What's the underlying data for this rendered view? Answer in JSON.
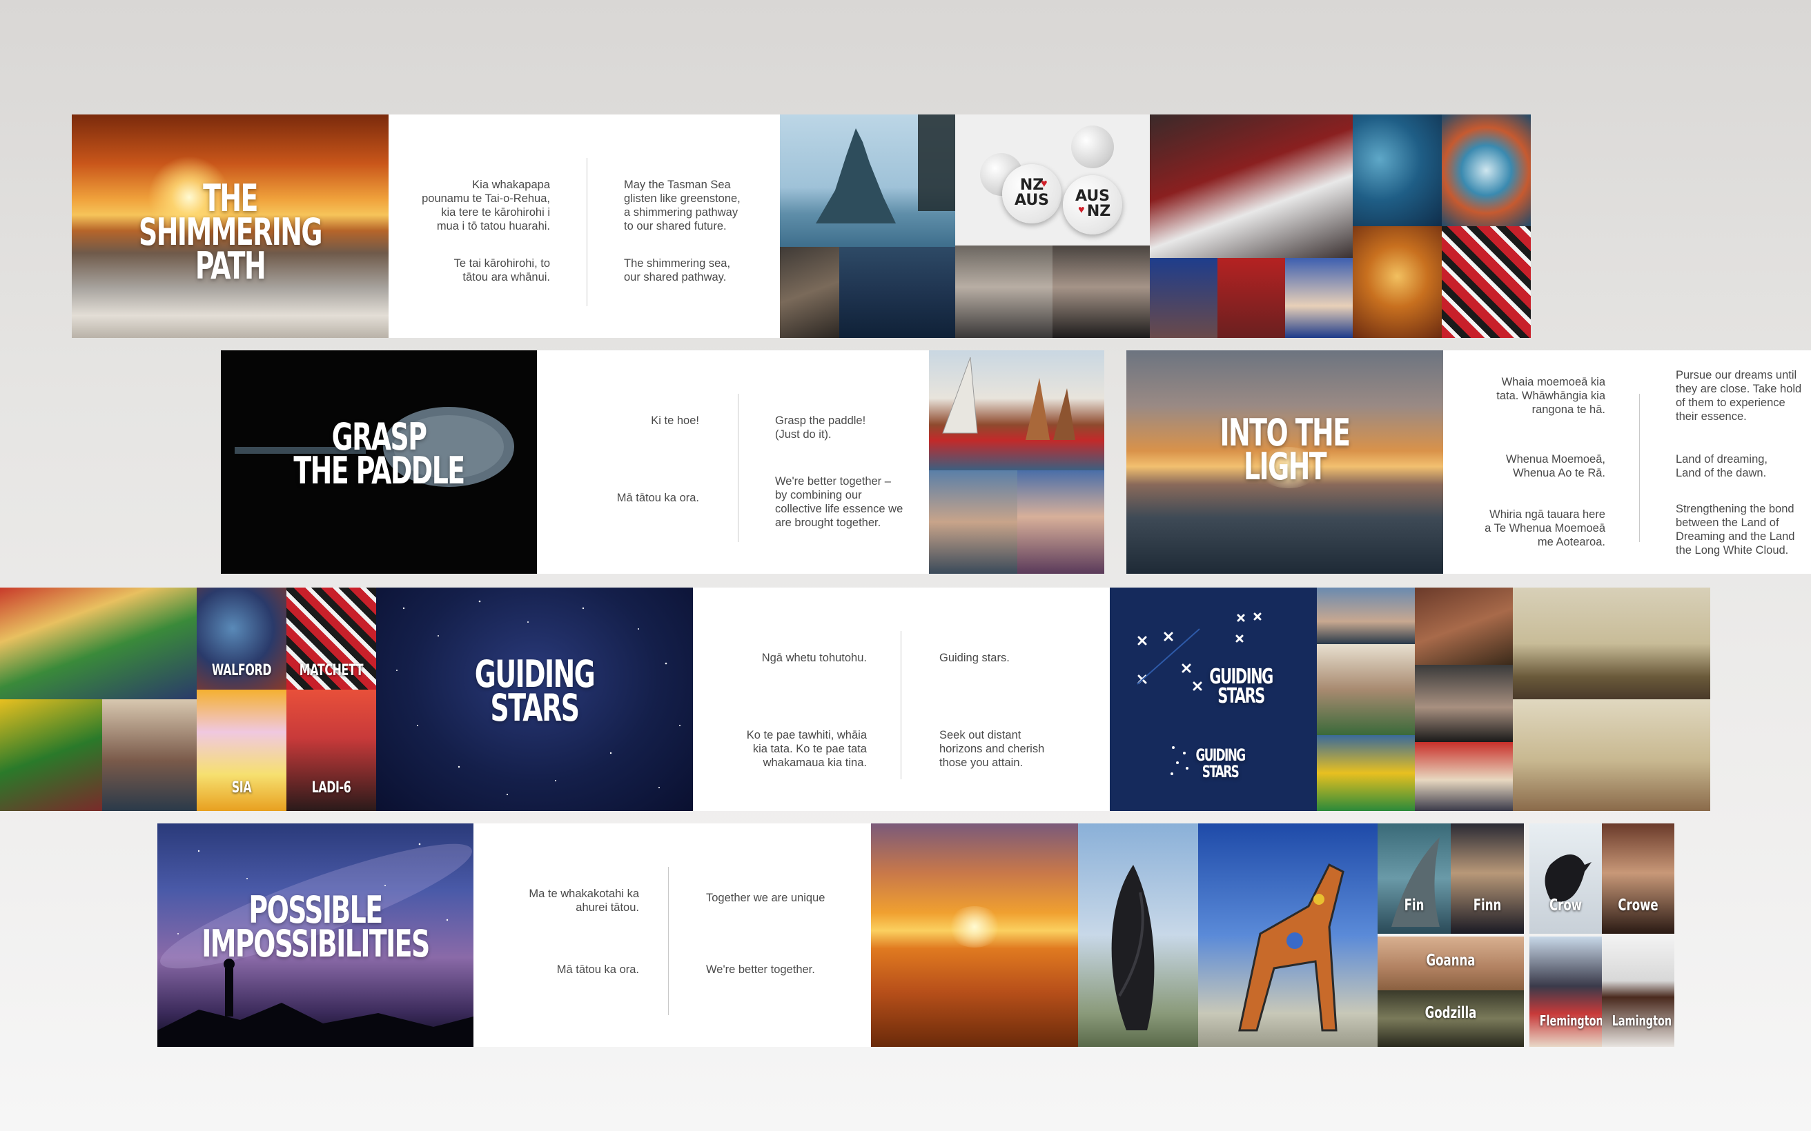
{
  "row1": {
    "cover": {
      "title_line1": "THE",
      "title_line2": "SHIMMERING",
      "title_line3": "PATH"
    },
    "verse_maori_a": "Kia whakapapa\npounamu te Tai-o-Rehua,\nkia tere te kārohirohi i\nmua i tō tatou huarahi.",
    "verse_maori_b": "Te tai kārohirohi, to\ntātou ara whānui.",
    "verse_english_a": "May the Tasman Sea\nglisten like greenstone,\na shimmering pathway\nto our shared future.",
    "verse_english_b": "The shimmering sea,\nour shared pathway.",
    "badge_nz_aus_line1": "NZ",
    "badge_nz_aus_line2": "AUS",
    "badge_aus_nz_line1": "AUS",
    "badge_aus_nz_line2": "NZ"
  },
  "row2": {
    "cover": {
      "title_line1": "GRASP",
      "title_line2": "THE PADDLE"
    },
    "verse_maori_a": "Ki te hoe!",
    "verse_maori_b": "Mā tātou ka ora.",
    "verse_english_a": "Grasp the paddle!\n(Just do it).",
    "verse_english_b": "We're better together –\nby combining our\ncollective life essence we\nare brought together.",
    "cover2": {
      "title_line1": "INTO THE",
      "title_line2": "LIGHT"
    },
    "verse2_maori_a": "Whaia moemoeā kia\ntata. Whāwhāngia kia\nrangona te hā.",
    "verse2_maori_b": "Whenua Moemoeā,\nWhenua Ao te Rā.",
    "verse2_maori_c": "Whiria ngā tauara here\na Te Whenua Moemoeā\nme Aotearoa.",
    "verse2_english_a": "Pursue our dreams until\nthey are close. Take hold\nof them to experience\ntheir essence.",
    "verse2_english_b": "Land of dreaming,\nLand of the dawn.",
    "verse2_english_c": "Strengthening the bond\nbetween the Land of\nDreaming and the Land\nthe Long White Cloud."
  },
  "row3": {
    "label_walford": "WALFORD",
    "label_matchett": "MATCHETT",
    "label_sia": "SIA",
    "label_ladi6": "LADI-6",
    "cover": {
      "title_line1": "GUIDING",
      "title_line2": "STARS"
    },
    "verse_maori_a": "Ngā whetu tohutohu.",
    "verse_maori_b": "Ko te pae tawhiti, whāia\nkia tata. Ko te pae tata\nwhakamaua kia tina.",
    "verse_english_a": "Guiding stars.",
    "verse_english_b": "Seek out distant\nhorizons and cherish\nthose you attain.",
    "poster_title_line1": "GUIDING",
    "poster_title_line2": "STARS",
    "poster_small_line1": "GUIDING",
    "poster_small_line2": "STARS"
  },
  "row4": {
    "cover": {
      "title_line1": "POSSIBLE",
      "title_line2": "IMPOSSIBILITIES"
    },
    "verse_maori_a": "Ma te whakakotahi ka\nahurei tātou.",
    "verse_maori_b": "Mā tātou ka ora.",
    "verse_english_a": "Together we are unique",
    "verse_english_b": "We're better together.",
    "cap_fin": "Fin",
    "cap_finn": "Finn",
    "cap_crow": "Crow",
    "cap_crowe": "Crowe",
    "cap_goanna": "Goanna",
    "cap_godzilla": "Godzilla",
    "cap_flemington": "Flemington",
    "cap_lamington": "Lamington"
  }
}
